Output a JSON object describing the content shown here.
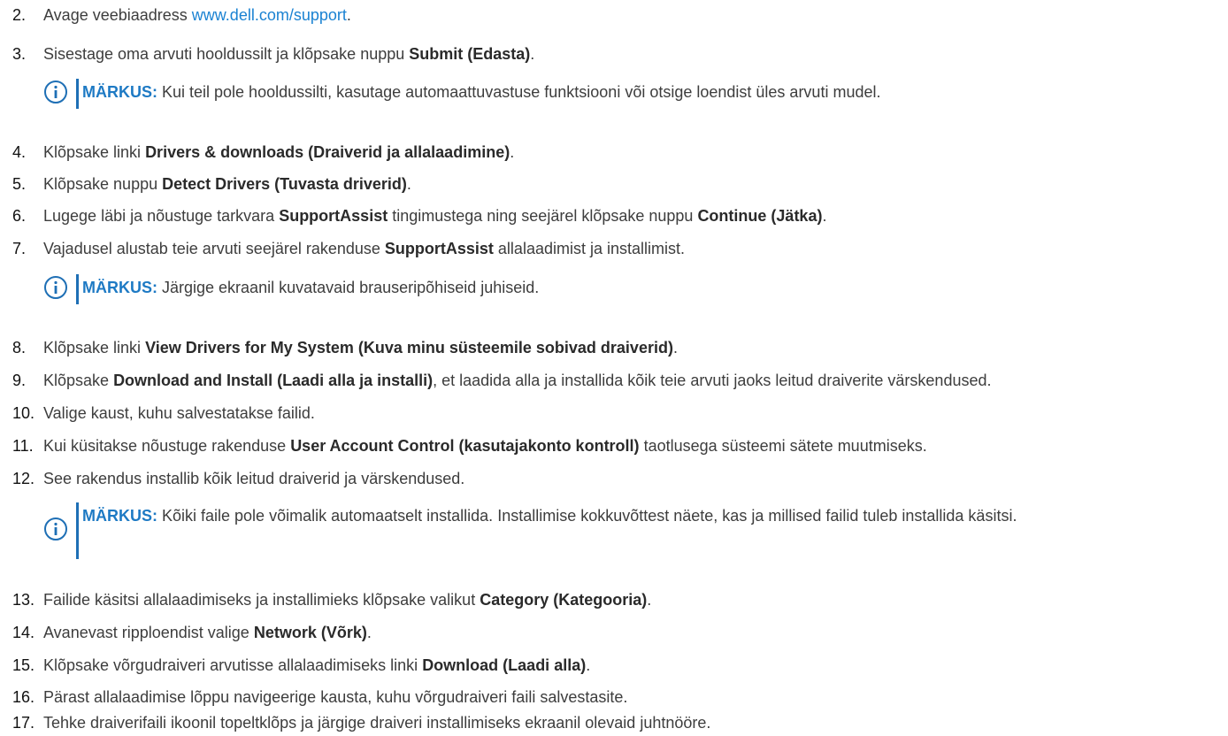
{
  "steps": [
    {
      "num": "2.",
      "parts": [
        "Avage veebiaadress ",
        "www.dell.com/support",
        "."
      ]
    },
    {
      "num": "3.",
      "parts": [
        "Sisestage oma arvuti hooldussilt ja klõpsake nuppu ",
        "Submit (Edasta)",
        "."
      ]
    },
    {
      "num": "4.",
      "parts": [
        "Klõpsake linki ",
        "Drivers & downloads (Draiverid ja allalaadimine)",
        "."
      ]
    },
    {
      "num": "5.",
      "parts": [
        "Klõpsake nuppu ",
        "Detect Drivers (Tuvasta driverid)",
        "."
      ]
    },
    {
      "num": "6.",
      "parts": [
        "Lugege läbi ja nõustuge tarkvara ",
        "SupportAssist",
        " tingimustega ning seejärel klõpsake nuppu ",
        "Continue (Jätka)",
        "."
      ]
    },
    {
      "num": "7.",
      "parts": [
        "Vajadusel alustab teie arvuti seejärel rakenduse ",
        "SupportAssist",
        " allalaadimist ja installimist."
      ]
    },
    {
      "num": "8.",
      "parts": [
        "Klõpsake linki ",
        "View Drivers for My System (Kuva minu süsteemile sobivad draiverid)",
        "."
      ]
    },
    {
      "num": "9.",
      "parts": [
        "Klõpsake ",
        "Download and Install (Laadi alla ja installi)",
        ", et laadida alla ja installida kõik teie arvuti jaoks leitud draiverite värskendused."
      ]
    },
    {
      "num": "10.",
      "parts": [
        "Valige kaust, kuhu salvestatakse failid."
      ]
    },
    {
      "num": "11.",
      "parts": [
        "Kui küsitakse nõustuge rakenduse ",
        "User Account Control (kasutajakonto kontroll)",
        " taotlusega süsteemi sätete muutmiseks."
      ]
    },
    {
      "num": "12.",
      "parts": [
        "See rakendus installib kõik leitud draiverid ja värskendused."
      ]
    },
    {
      "num": "13.",
      "parts": [
        "Failide käsitsi allalaadimiseks ja installimieks klõpsake valikut ",
        "Category (Kategooria)",
        "."
      ]
    },
    {
      "num": "14.",
      "parts": [
        "Avanevast ripploendist valige ",
        "Network (Võrk)",
        "."
      ]
    },
    {
      "num": "15.",
      "parts": [
        "Klõpsake võrgudraiveri arvutisse allalaadimiseks linki ",
        "Download (Laadi alla)",
        "."
      ]
    },
    {
      "num": "16.",
      "parts": [
        "Pärast allalaadimise lõppu navigeerige kausta, kuhu võrgudraiveri faili salvestasite."
      ]
    },
    {
      "num": "17.",
      "parts": [
        "Tehke draiverifaili ikoonil topeltklõps ja järgige draiveri installimiseks ekraanil olevaid juhtnööre."
      ]
    }
  ],
  "notes": [
    {
      "label": "MÄRKUS:",
      "text": " Kui teil pole hooldussilti, kasutage automaattuvastuse funktsiooni või otsige loendist üles arvuti mudel."
    },
    {
      "label": "MÄRKUS:",
      "text": " Järgige ekraanil kuvatavaid brauseripõhiseid juhiseid."
    },
    {
      "label": "MÄRKUS:",
      "text": " Kõiki faile pole võimalik automaatselt installida. Installimise kokkuvõttest näete, kas ja millised failid tuleb installida käsitsi."
    }
  ],
  "colors": {
    "link": "#1a82d2",
    "note_label": "#1e7ac4",
    "note_bar": "#1e6fb5"
  },
  "icons": {
    "note": "info-circle-icon"
  }
}
